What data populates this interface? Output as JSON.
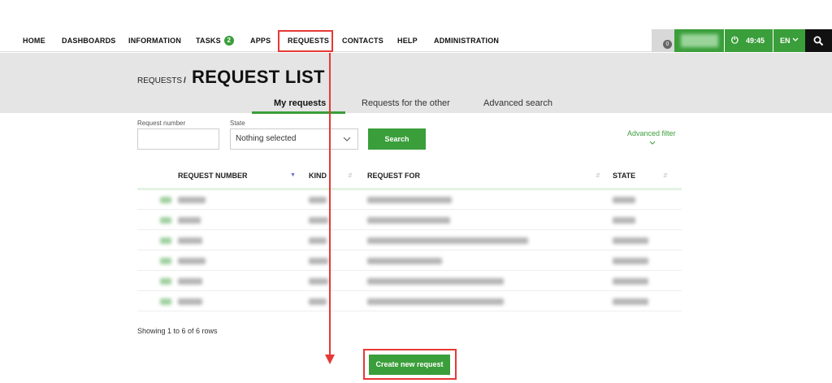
{
  "nav": {
    "items": [
      {
        "label": "HOME"
      },
      {
        "label": "DASHBOARDS"
      },
      {
        "label": "INFORMATION"
      },
      {
        "label": "TASKS"
      },
      {
        "label": "APPS"
      },
      {
        "label": "REQUESTS"
      },
      {
        "label": "CONTACTS"
      },
      {
        "label": "HELP"
      },
      {
        "label": "ADMINISTRATION"
      }
    ],
    "tasks_count": "2",
    "notifications_count": "0",
    "session_timer": "49:45",
    "language": "EN",
    "power_icon": "power-icon",
    "search_icon": "search-icon"
  },
  "header": {
    "breadcrumb": "REQUESTS",
    "separator": "/",
    "title": "REQUEST LIST",
    "tabs": [
      {
        "label": "My requests",
        "active": true
      },
      {
        "label": "Requests for the other",
        "active": false
      },
      {
        "label": "Advanced search",
        "active": false
      }
    ]
  },
  "filters": {
    "request_number_label": "Request number",
    "request_number_value": "",
    "state_label": "State",
    "state_value": "Nothing selected",
    "search_label": "Search",
    "advanced_filter_label": "Advanced filter"
  },
  "table": {
    "columns": [
      "REQUEST NUMBER",
      "KIND",
      "REQUEST FOR",
      "STATE"
    ],
    "sorted_column": "REQUEST NUMBER",
    "row_count": 6,
    "showing_text": "Showing 1 to 6 of 6 rows"
  },
  "create_button_label": "Create new request",
  "colors": {
    "accent": "#3a9e3a",
    "highlight": "#e53935",
    "band": "#e5e5e5"
  }
}
